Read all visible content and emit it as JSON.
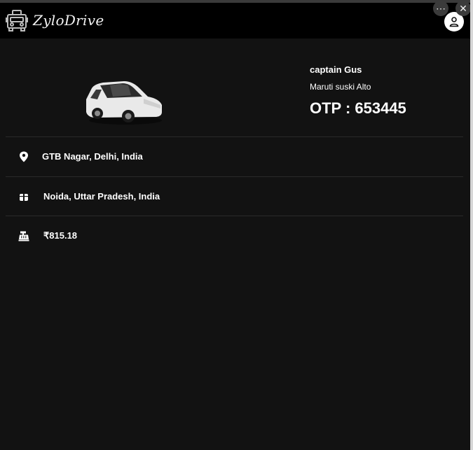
{
  "app": {
    "brand": "ZyloDrive"
  },
  "window": {
    "more_symbol": "⋯",
    "close_symbol": "✕"
  },
  "ride": {
    "captain_name": "captain Gus",
    "car_model": "Maruti suski Alto",
    "otp_label": "OTP : 653445"
  },
  "details": [
    {
      "icon": "location-pin-icon",
      "text": "GTB Nagar, Delhi, India"
    },
    {
      "icon": "package-icon",
      "text": "Noida, Uttar Pradesh, India"
    },
    {
      "icon": "cash-register-icon",
      "text": "₹815.18"
    }
  ],
  "colors": {
    "background": "#121212",
    "navbar": "#000000",
    "text": "#ffffff",
    "divider": "#2a2a2a"
  }
}
